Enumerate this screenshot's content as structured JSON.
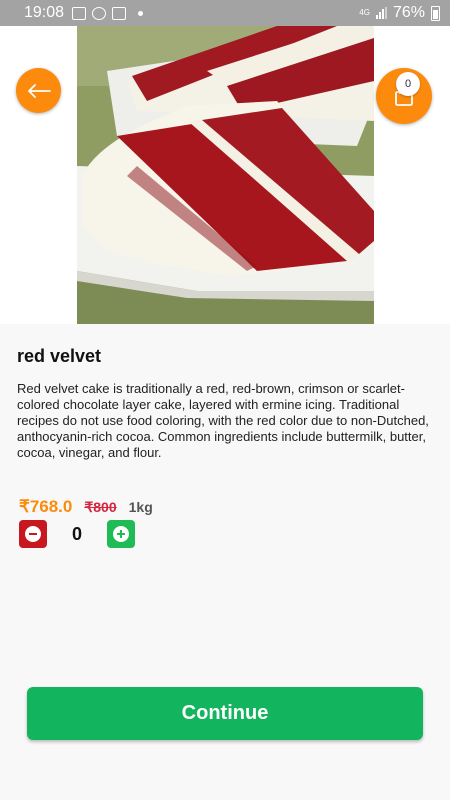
{
  "status_bar": {
    "time": "19:08",
    "network": "4G",
    "battery": "76%"
  },
  "header": {
    "cart_count": "0"
  },
  "product": {
    "title": "red velvet",
    "description": "Red velvet cake is traditionally a red, red-brown, crimson or scarlet-colored chocolate layer cake, layered with ermine icing. Traditional recipes do not use food coloring, with the red color due to non-Dutched, anthocyanin-rich cocoa. Common ingredients include buttermilk, butter, cocoa, vinegar, and flour.",
    "price": "₹768.0",
    "original_price": "₹800",
    "unit": "1kg",
    "quantity": "0"
  },
  "actions": {
    "continue_label": "Continue"
  },
  "icons": {
    "back": "arrow-left-icon",
    "cart": "shopping-bag-icon",
    "minus": "minus-circle-icon",
    "plus": "plus-circle-icon"
  },
  "colors": {
    "accent": "#fb8a0d",
    "primary": "#12b55d",
    "minus": "#c8181f",
    "plus": "#1fbb55",
    "strike_price": "#d3273f"
  }
}
